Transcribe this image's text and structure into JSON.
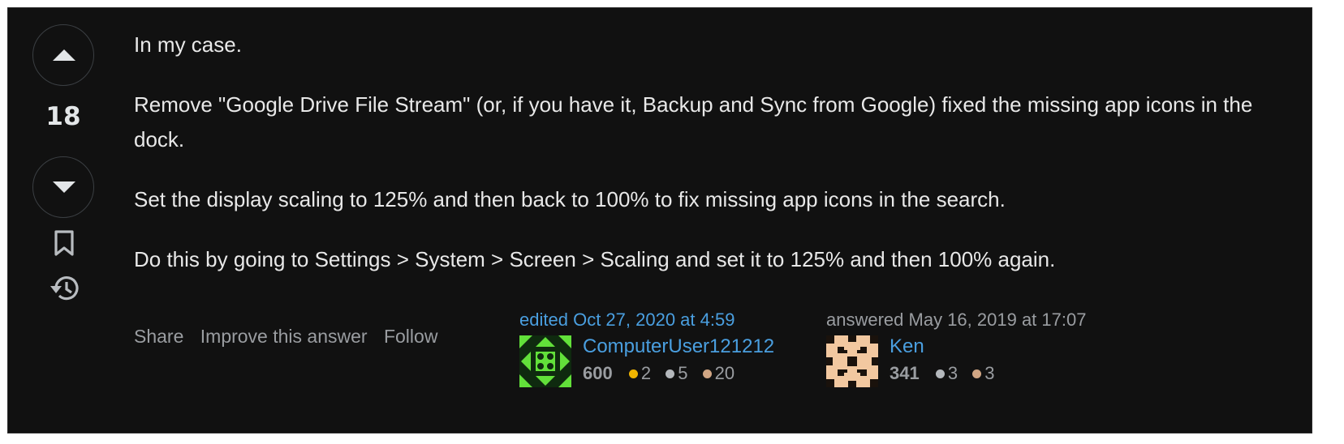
{
  "post": {
    "vote_count": "18",
    "paragraphs": [
      "In my case.",
      "Remove \"Google Drive File Stream\" (or, if you have it, Backup and Sync from Google) fixed the missing app icons in the dock.",
      "Set the display scaling to 125% and then back to 100% to fix missing app icons in the search.",
      "Do this by going to Settings > System > Screen > Scaling and set it to 125% and then 100% again."
    ]
  },
  "menu": {
    "share": "Share",
    "improve": "Improve this answer",
    "follow": "Follow"
  },
  "editor": {
    "action": "edited",
    "time": "Oct 27, 2020 at 4:59",
    "name": "ComputerUser121212",
    "reputation": "600",
    "gold": "2",
    "silver": "5",
    "bronze": "20"
  },
  "author": {
    "action": "answered",
    "time": "May 16, 2019 at 17:07",
    "name": "Ken",
    "reputation": "341",
    "silver": "3",
    "bronze": "3"
  },
  "colors": {
    "background": "#111111",
    "link": "#4a9fe0",
    "muted": "#9a9da1",
    "gold": "#f0b400",
    "silver": "#b4b8bc",
    "bronze": "#d1a684"
  },
  "icons": [
    "arrow-up-icon",
    "arrow-down-icon",
    "bookmark-icon",
    "history-icon"
  ]
}
